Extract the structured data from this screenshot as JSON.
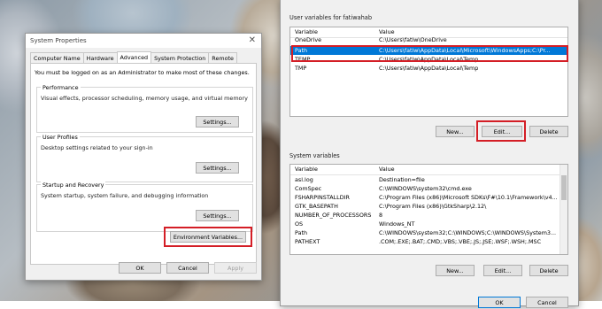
{
  "system_properties": {
    "title": "System Properties",
    "close": "✕",
    "tabs": [
      "Computer Name",
      "Hardware",
      "Advanced",
      "System Protection",
      "Remote"
    ],
    "note": "You must be logged on as an Administrator to make most of these changes.",
    "performance": {
      "title": "Performance",
      "desc": "Visual effects, processor scheduling, memory usage, and virtual memory",
      "button": "Settings..."
    },
    "user_profiles": {
      "title": "User Profiles",
      "desc": "Desktop settings related to your sign-in",
      "button": "Settings..."
    },
    "startup": {
      "title": "Startup and Recovery",
      "desc": "System startup, system failure, and debugging information",
      "button": "Settings..."
    },
    "env_button": "Environment Variables...",
    "ok": "OK",
    "cancel": "Cancel",
    "apply": "Apply"
  },
  "env_vars": {
    "user_section": "User variables for fatiwahab",
    "col_variable": "Variable",
    "col_value": "Value",
    "user_rows": [
      {
        "name": "OneDrive",
        "value": "C:\\Users\\fatiw\\OneDrive"
      },
      {
        "name": "Path",
        "value": "C:\\Users\\fatiw\\AppData\\Local\\Microsoft\\WindowsApps;C:\\Pr..."
      },
      {
        "name": "TEMP",
        "value": "C:\\Users\\fatiw\\AppData\\Local\\Temp"
      },
      {
        "name": "TMP",
        "value": "C:\\Users\\fatiw\\AppData\\Local\\Temp"
      }
    ],
    "user_buttons": {
      "new": "New...",
      "edit": "Edit...",
      "delete": "Delete"
    },
    "system_section": "System variables",
    "system_rows": [
      {
        "name": "asl.log",
        "value": "Destination=file"
      },
      {
        "name": "ComSpec",
        "value": "C:\\WINDOWS\\system32\\cmd.exe"
      },
      {
        "name": "FSHARPINSTALLDIR",
        "value": "C:\\Program Files (x86)\\Microsoft SDKs\\F#\\10.1\\Framework\\v4..."
      },
      {
        "name": "GTK_BASEPATH",
        "value": "C:\\Program Files (x86)\\GtkSharp\\2.12\\"
      },
      {
        "name": "NUMBER_OF_PROCESSORS",
        "value": "8"
      },
      {
        "name": "OS",
        "value": "Windows_NT"
      },
      {
        "name": "Path",
        "value": "C:\\WINDOWS\\system32;C:\\WINDOWS;C:\\WINDOWS\\System3..."
      },
      {
        "name": "PATHEXT",
        "value": ".COM;.EXE;.BAT;.CMD;.VBS;.VBE;.JS;.JSE;.WSF;.WSH;.MSC"
      }
    ],
    "system_buttons": {
      "new": "New...",
      "edit": "Edit...",
      "delete": "Delete"
    },
    "ok": "OK",
    "cancel": "Cancel"
  }
}
